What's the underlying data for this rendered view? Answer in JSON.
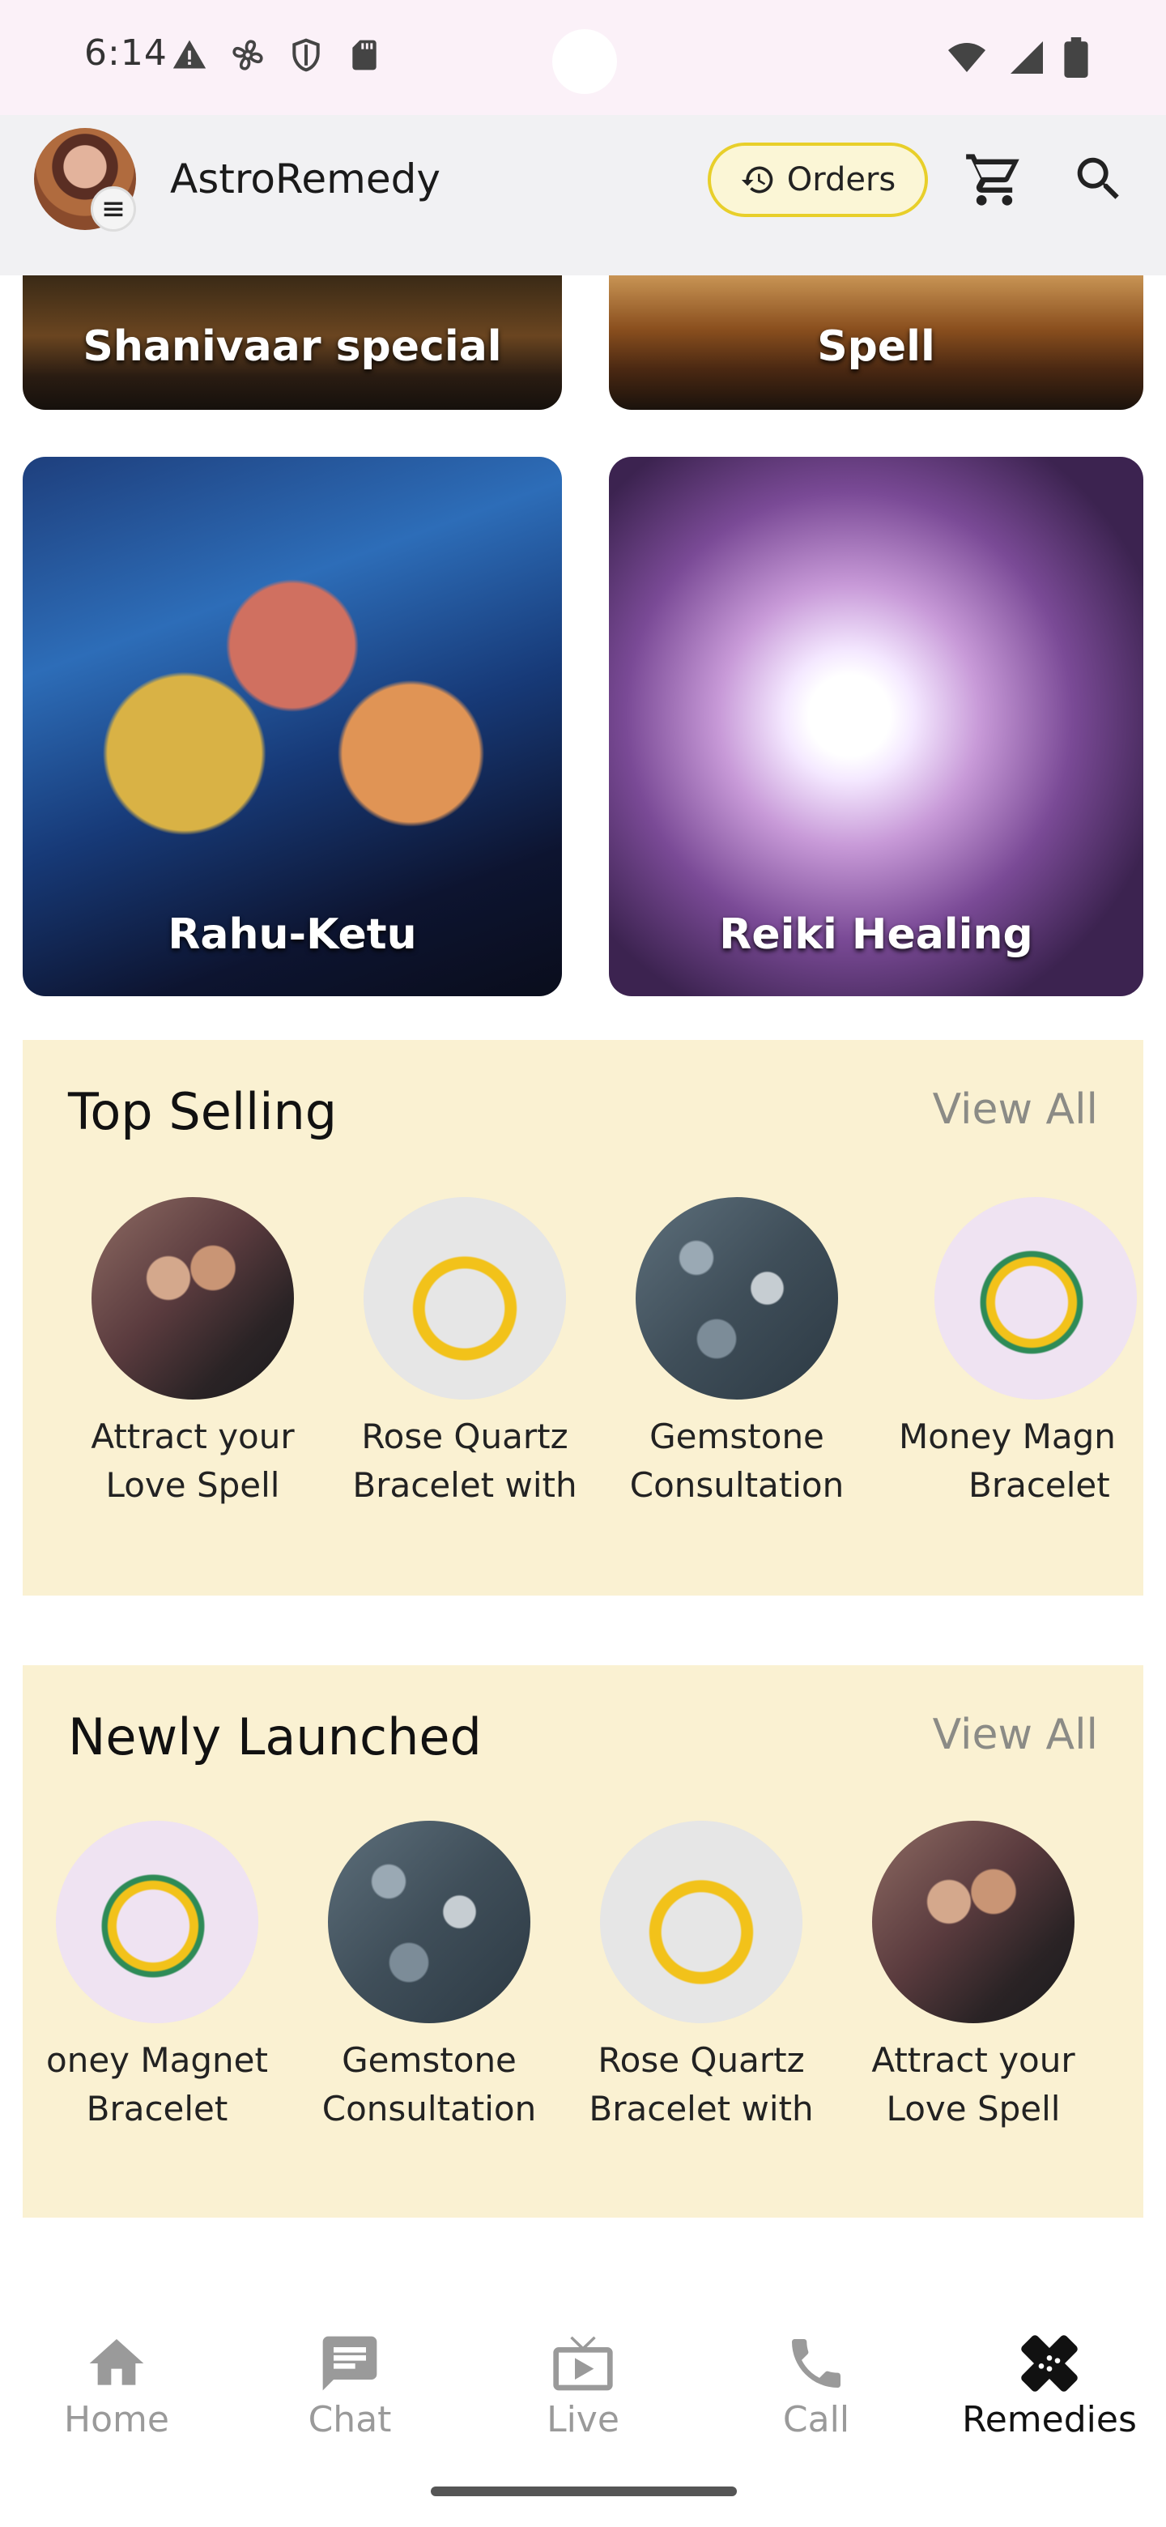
{
  "status_bar": {
    "time": "6:14",
    "left_icons": [
      "warning-icon",
      "fan-icon",
      "shield-icon",
      "sd-card-icon"
    ],
    "right_icons": [
      "wifi-icon",
      "signal-icon",
      "battery-icon"
    ]
  },
  "app_bar": {
    "title": "AstroRemedy",
    "orders_label": "Orders",
    "accent_color": "#e8cf2a"
  },
  "categories": [
    {
      "label": "Shanivaar special"
    },
    {
      "label": "Spell"
    },
    {
      "label": "Rahu-Ketu"
    },
    {
      "label": "Reiki Healing"
    }
  ],
  "top_selling": {
    "title": "Top Selling",
    "view_all": "View All",
    "items": [
      {
        "line1": "Attract your",
        "line2": "Love Spell"
      },
      {
        "line1": "Rose Quartz",
        "line2": "Bracelet with"
      },
      {
        "line1": "Gemstone",
        "line2": "Consultation"
      },
      {
        "line1": "Money Magn",
        "line2": "Bracelet"
      }
    ]
  },
  "newly_launched": {
    "title": "Newly Launched",
    "view_all": "View All",
    "items": [
      {
        "line1": "oney Magnet",
        "line2": "Bracelet"
      },
      {
        "line1": "Gemstone",
        "line2": "Consultation"
      },
      {
        "line1": "Rose Quartz",
        "line2": "Bracelet with"
      },
      {
        "line1": "Attract your",
        "line2": "Love Spell"
      }
    ]
  },
  "section_background": "#faf1d2",
  "bottom_nav": {
    "items": [
      {
        "label": "Home",
        "icon": "home-icon"
      },
      {
        "label": "Chat",
        "icon": "chat-icon"
      },
      {
        "label": "Live",
        "icon": "live-tv-icon"
      },
      {
        "label": "Call",
        "icon": "phone-icon"
      },
      {
        "label": "Remedies",
        "icon": "remedies-icon"
      }
    ],
    "active": "Remedies"
  }
}
